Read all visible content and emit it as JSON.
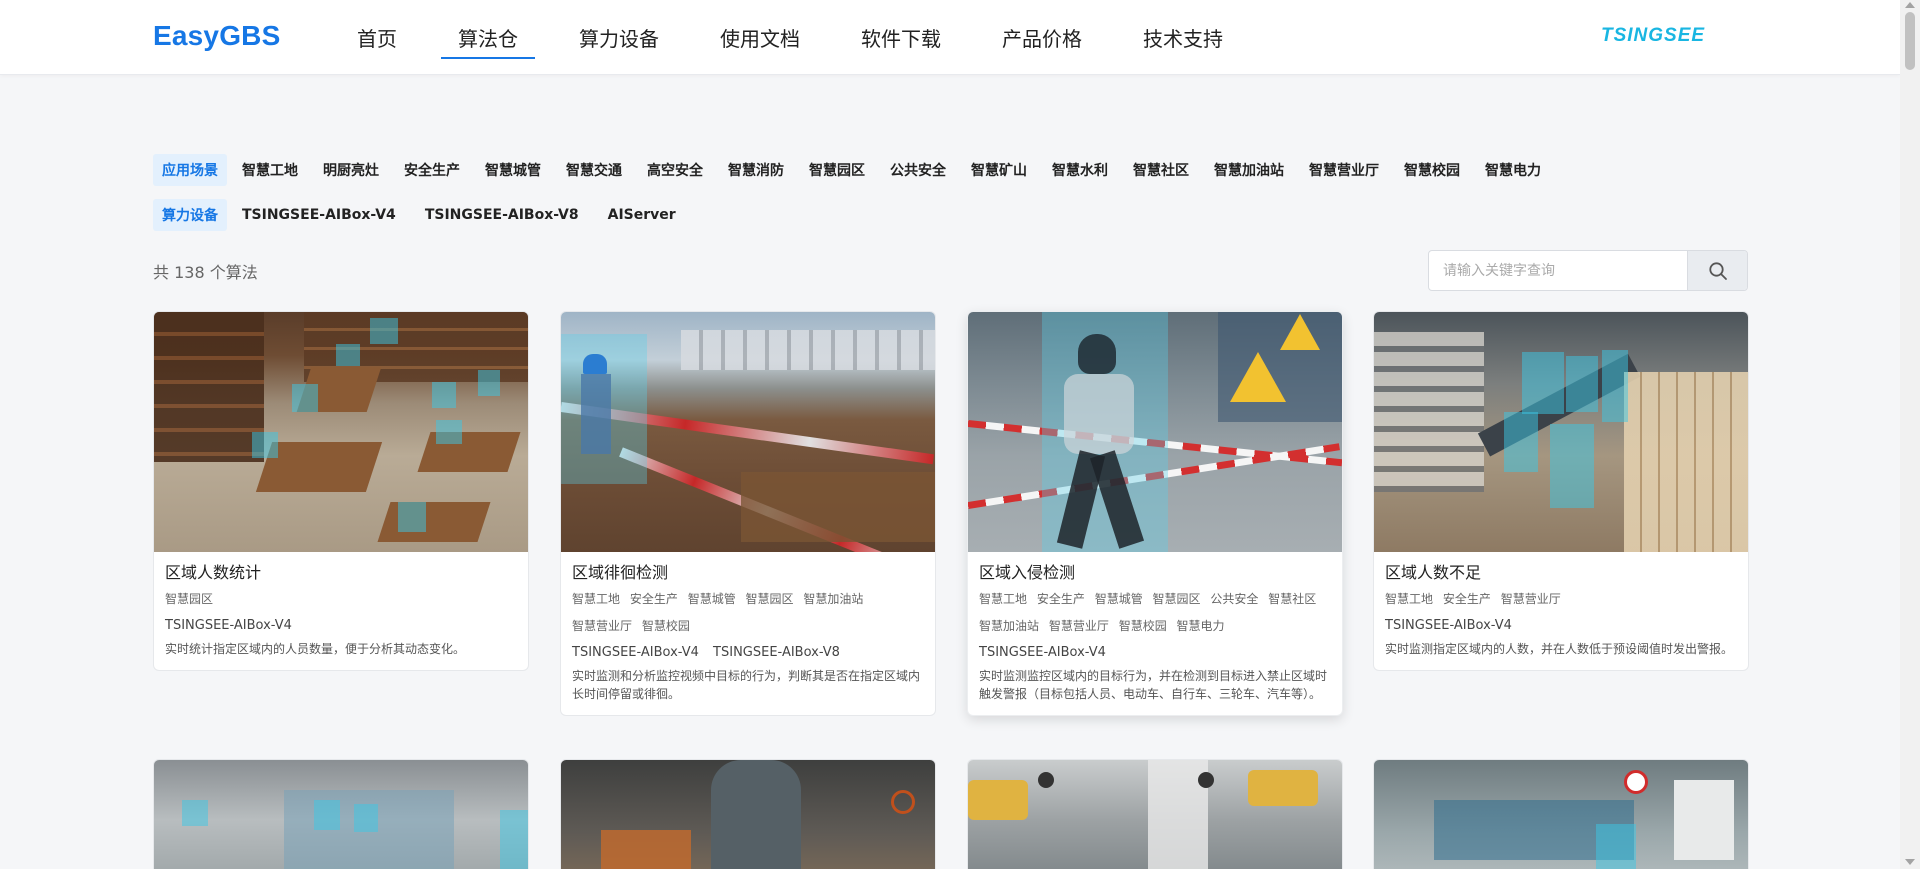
{
  "header": {
    "logo": "EasyGBS",
    "nav": [
      {
        "label": "首页",
        "active": false
      },
      {
        "label": "算法仓",
        "active": true
      },
      {
        "label": "算力设备",
        "active": false
      },
      {
        "label": "使用文档",
        "active": false
      },
      {
        "label": "软件下载",
        "active": false
      },
      {
        "label": "产品价格",
        "active": false
      },
      {
        "label": "技术支持",
        "active": false
      }
    ],
    "brand": "TSINGSEE"
  },
  "filters": {
    "scenes_label": "应用场景",
    "scenes": [
      "智慧工地",
      "明厨亮灶",
      "安全生产",
      "智慧城管",
      "智慧交通",
      "高空安全",
      "智慧消防",
      "智慧园区",
      "公共安全",
      "智慧矿山",
      "智慧水利",
      "智慧社区",
      "智慧加油站",
      "智慧营业厅",
      "智慧校园",
      "智慧电力"
    ],
    "devices_label": "算力设备",
    "devices": [
      "TSINGSEE-AIBox-V4",
      "TSINGSEE-AIBox-V8",
      "AIServer"
    ]
  },
  "summary": {
    "count_text": "共 138 个算法"
  },
  "search": {
    "placeholder": "请输入关键字查询",
    "icon": "search-icon"
  },
  "cards": [
    {
      "title": "区域人数统计",
      "tags": [
        "智慧园区"
      ],
      "devices": [
        "TSINGSEE-AIBox-V4"
      ],
      "desc": "实时统计指定区域内的人员数量，便于分析其动态变化。"
    },
    {
      "title": "区域徘徊检测",
      "tags": [
        "智慧工地",
        "安全生产",
        "智慧城管",
        "智慧园区",
        "智慧加油站",
        "智慧营业厅",
        "智慧校园"
      ],
      "devices": [
        "TSINGSEE-AIBox-V4",
        "TSINGSEE-AIBox-V8"
      ],
      "desc": "实时监测和分析监控视频中目标的行为，判断其是否在指定区域内长时间停留或徘徊。"
    },
    {
      "title": "区域入侵检测",
      "tags": [
        "智慧工地",
        "安全生产",
        "智慧城管",
        "智慧园区",
        "公共安全",
        "智慧社区",
        "智慧加油站",
        "智慧营业厅",
        "智慧校园",
        "智慧电力"
      ],
      "devices": [
        "TSINGSEE-AIBox-V4"
      ],
      "desc": "实时监测监控区域内的目标行为，并在检测到目标进入禁止区域时触发警报（目标包括人员、电动车、自行车、三轮车、汽车等）。"
    },
    {
      "title": "区域人数不足",
      "tags": [
        "智慧工地",
        "安全生产",
        "智慧营业厅"
      ],
      "devices": [
        "TSINGSEE-AIBox-V4"
      ],
      "desc": "实时监测指定区域内的人数，并在人数低于预设阈值时发出警报。"
    }
  ],
  "colors": {
    "accent": "#1677e5",
    "brand": "#19b6e2",
    "detection": "#3cc8e6"
  }
}
